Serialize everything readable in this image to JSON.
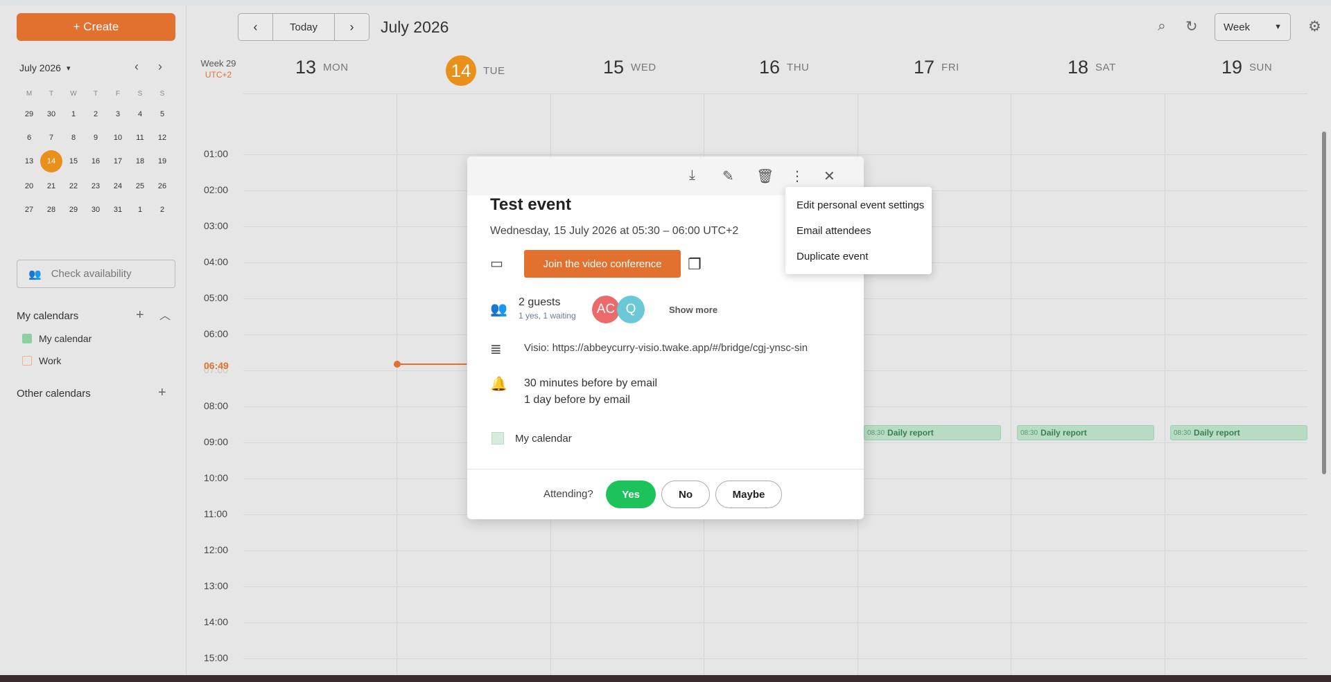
{
  "colors": {
    "accent": "#e2712f",
    "today": "#e8901a",
    "event_green": "#b7dcc3",
    "yes_green": "#1ec25a"
  },
  "sidebar": {
    "create_label": "+ Create",
    "mini_calendar": {
      "title": "July 2026",
      "weekdays": [
        "M",
        "T",
        "W",
        "T",
        "F",
        "S",
        "S"
      ],
      "weeks": [
        [
          "29",
          "30",
          "1",
          "2",
          "3",
          "4",
          "5"
        ],
        [
          "6",
          "7",
          "8",
          "9",
          "10",
          "11",
          "12"
        ],
        [
          "13",
          "14",
          "15",
          "16",
          "17",
          "18",
          "19"
        ],
        [
          "20",
          "21",
          "22",
          "23",
          "24",
          "25",
          "26"
        ],
        [
          "27",
          "28",
          "29",
          "30",
          "31",
          "1",
          "2"
        ]
      ],
      "today": "14"
    },
    "check_availability": "Check availability",
    "my_calendars_title": "My calendars",
    "my_calendars": [
      {
        "name": "My calendar",
        "checked": true,
        "color": "#8fcfa2"
      },
      {
        "name": "Work",
        "checked": false,
        "color": "#f0b48a"
      }
    ],
    "other_calendars_title": "Other calendars"
  },
  "toolbar": {
    "today_label": "Today",
    "month_title": "July 2026",
    "view_select": "Week"
  },
  "week": {
    "week_label": "Week 29",
    "tz_label": "UTC+2",
    "days": [
      {
        "num": "13",
        "name": "MON"
      },
      {
        "num": "14",
        "name": "TUE",
        "today": true
      },
      {
        "num": "15",
        "name": "WED"
      },
      {
        "num": "16",
        "name": "THU"
      },
      {
        "num": "17",
        "name": "FRI"
      },
      {
        "num": "18",
        "name": "SAT"
      },
      {
        "num": "19",
        "name": "SUN"
      }
    ],
    "hours": [
      "01:00",
      "02:00",
      "03:00",
      "04:00",
      "05:00",
      "06:00",
      "07:00",
      "08:00",
      "09:00",
      "10:00",
      "11:00",
      "12:00",
      "13:00",
      "14:00",
      "15:00"
    ],
    "now_label": "06:49",
    "events": [
      {
        "time": "08:30",
        "title": "Daily report",
        "day": "FRI"
      },
      {
        "time": "08:30",
        "title": "Daily report",
        "day": "SAT"
      },
      {
        "time": "08:30",
        "title": "Daily report",
        "day": "SUN"
      }
    ]
  },
  "popup": {
    "title": "Test event",
    "date": "Wednesday, 15 July 2026 at 05:30 – 06:00 UTC+2",
    "join_label": "Join the video conference",
    "guests_count": "2 guests",
    "guests_status": "1 yes, 1 waiting",
    "avatars": [
      {
        "initials": "AC",
        "color": "#ec6a6a"
      },
      {
        "initials": "Q",
        "color": "#6bc9d6"
      }
    ],
    "show_more": "Show more",
    "description": "Visio: https://abbeycurry-visio.twake.app/#/bridge/cgj-ynsc-sin",
    "reminders": [
      "30 minutes before by email",
      "1 day before by email"
    ],
    "calendar": "My calendar",
    "attending_label": "Attending?",
    "rsvp": {
      "yes": "Yes",
      "no": "No",
      "maybe": "Maybe"
    }
  },
  "menu": {
    "items": [
      "Edit personal event settings",
      "Email attendees",
      "Duplicate event"
    ]
  }
}
